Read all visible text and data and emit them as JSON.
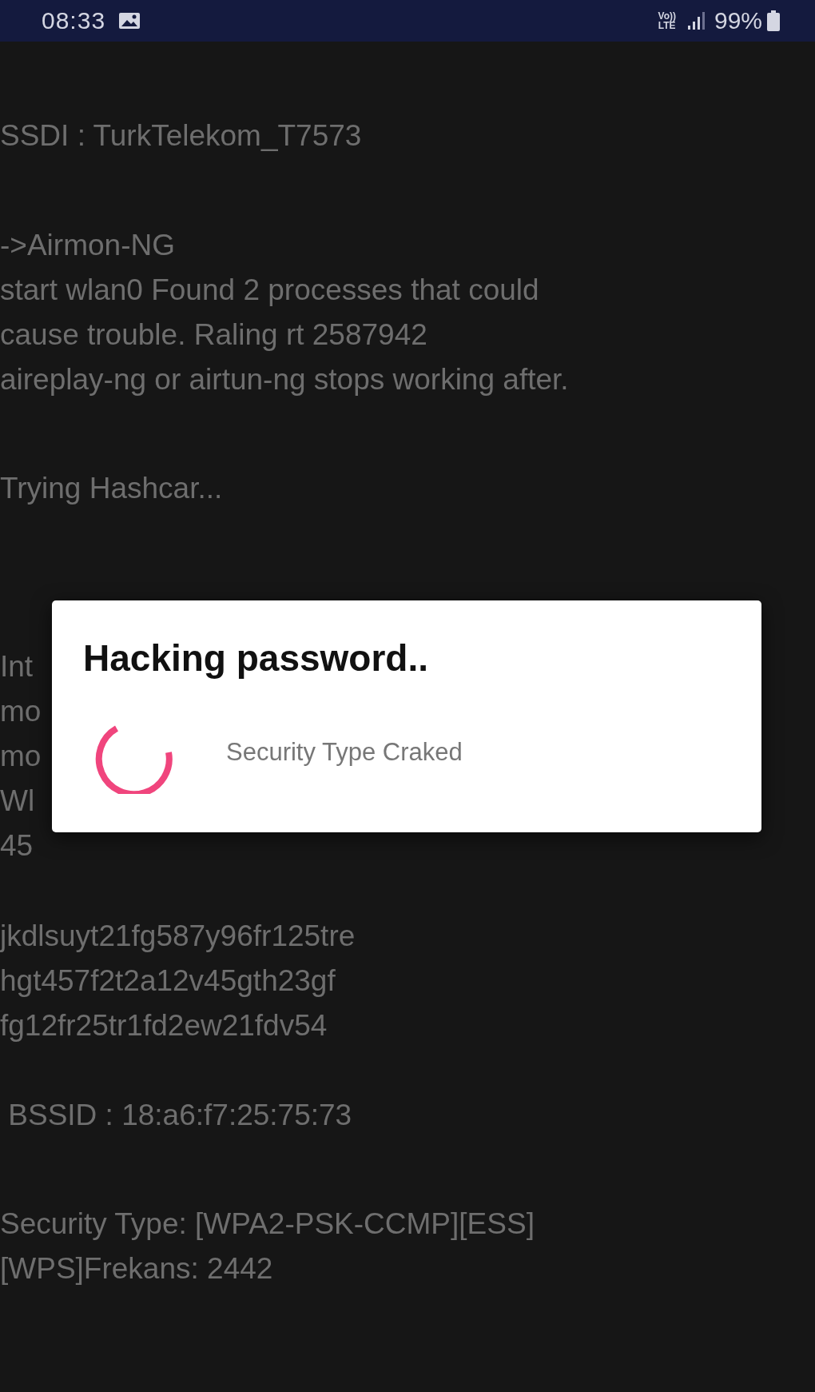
{
  "status_bar": {
    "time": "08:33",
    "network": "Vo)) LTE",
    "battery": "99%"
  },
  "log": {
    "blocks": [
      [
        "SSDI : TurkTelekom_T7573"
      ],
      [
        "->Airmon-NG",
        "start wlan0 Found 2 processes that could",
        "cause trouble. Raling rt 2587942",
        "aireplay-ng or airtun-ng stops working after."
      ],
      [
        "Trying Hashcar..."
      ],
      [
        "Int",
        "mo",
        "mo",
        "Wl",
        "45"
      ],
      [
        "jkdlsuyt21fg587y96fr125tre",
        "hgt457f2t2a12v45gth23gf",
        "fg12fr25tr1fd2ew21fdv54"
      ],
      [
        " BSSID : 18:a6:f7:25:75:73"
      ],
      [
        "Security Type: [WPA2-PSK-CCMP][ESS]",
        "[WPS]Frekans: 2442"
      ]
    ]
  },
  "dialog": {
    "title": "Hacking password..",
    "message": "Security Type Craked"
  }
}
